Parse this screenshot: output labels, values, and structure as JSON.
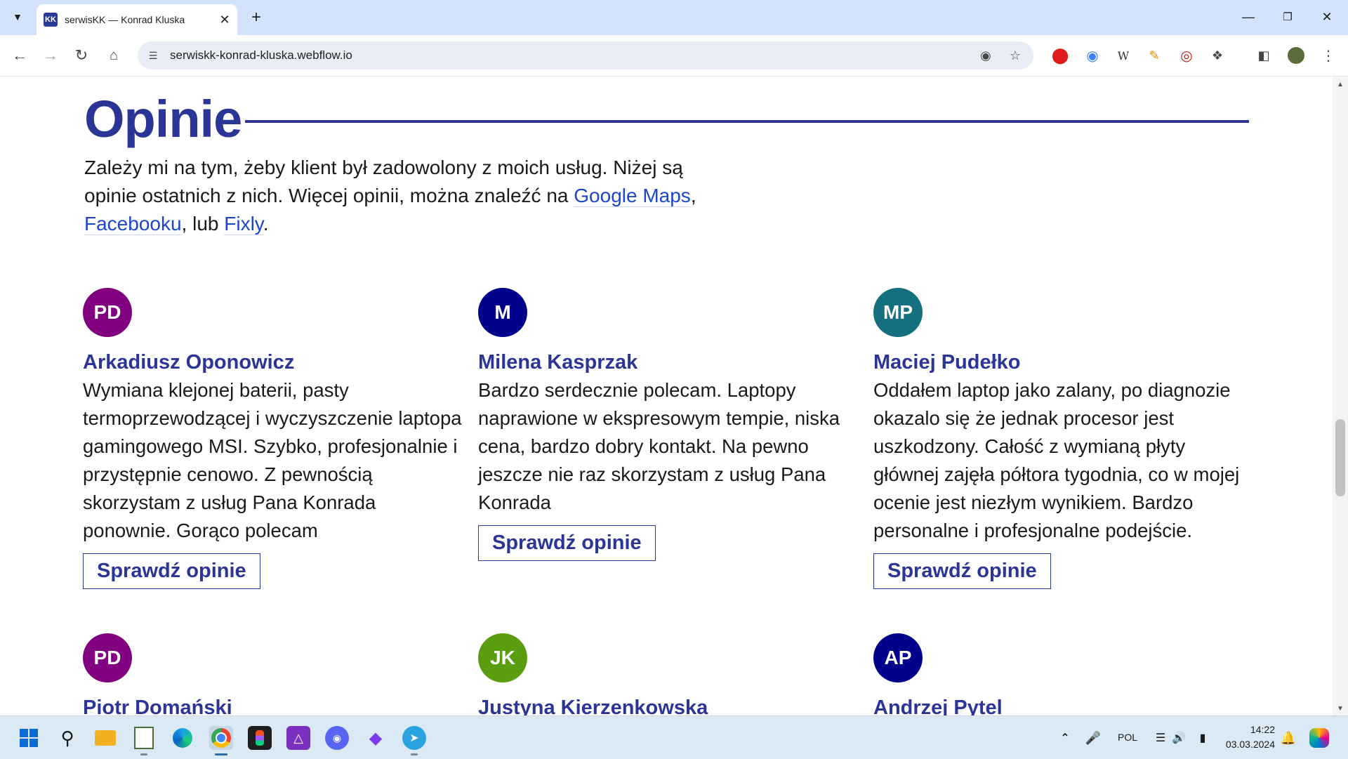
{
  "browser": {
    "tab_title": "serwisKK — Konrad Kluska",
    "tab_favicon_text": "KK",
    "url": "serwiskk-konrad-kluska.webflow.io"
  },
  "page": {
    "heading": "Opinie",
    "intro_text_1": "Zależy mi na tym, żeby klient był zadowolony z moich usług. Niżej są opinie ostatnich z nich. Więcej opinii, można znaleźć na ",
    "link_google": "Google Maps",
    "sep_1": ", ",
    "link_facebook": "Facebooku",
    "sep_2": ", lub ",
    "link_fixly": "Fixly",
    "end": ".",
    "button_label": "Sprawdź opinie",
    "reviews": [
      {
        "initials": "PD",
        "color": "#800080",
        "name": "Arkadiusz Oponowicz",
        "text": "Wymiana klejonej baterii, pasty termoprzewodzącej i wyczyszczenie laptopa gamingowego MSI. Szybko, profesjonalnie i przystępnie cenowo. Z pewnością skorzystam z usług Pana Konrada ponownie. Gorąco polecam"
      },
      {
        "initials": "M",
        "color": "#00008b",
        "name": "Milena Kasprzak",
        "text": "Bardzo serdecznie polecam. Laptopy naprawione w ekspresowym tempie, niska cena, bardzo dobry kontakt. Na pewno jeszcze nie raz skorzystam z usług Pana Konrada"
      },
      {
        "initials": "MP",
        "color": "#14707e",
        "name": "Maciej Pudełko",
        "text": "Oddałem laptop jako zalany, po diagnozie okazalo się że jednak procesor jest uszkodzony. Całość z wymianą płyty głównej zajęła półtora tygodnia, co w mojej ocenie jest niezłym wynikiem. Bardzo personalne i profesjonalne podejście."
      },
      {
        "initials": "PD",
        "color": "#800080",
        "name": "Piotr Domański"
      },
      {
        "initials": "JK",
        "color": "#5a9e10",
        "name": "Justyna Kierzenkowska"
      },
      {
        "initials": "AP",
        "color": "#00008b",
        "name": "Andrzej Pytel"
      }
    ]
  },
  "taskbar": {
    "language": "POL",
    "time": "14:22",
    "date": "03.03.2024"
  }
}
